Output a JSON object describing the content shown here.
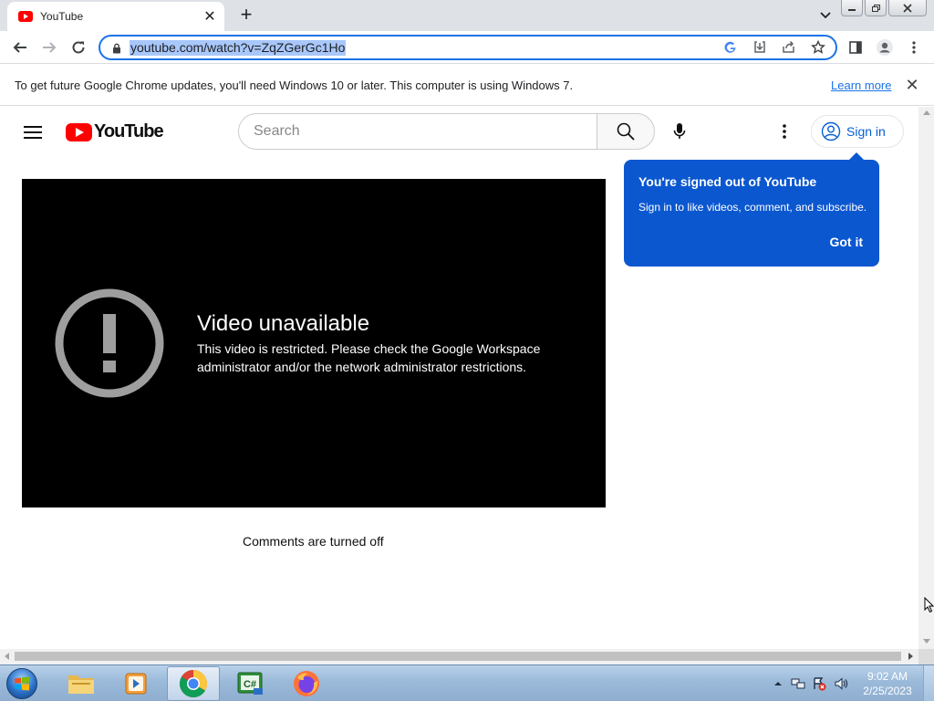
{
  "browser": {
    "tab": {
      "title": "YouTube",
      "close_glyph": "✕"
    },
    "new_tab_glyph": "+",
    "url": "youtube.com/watch?v=ZqZGerGc1Ho",
    "infobar": {
      "message": "To get future Google Chrome updates, you'll need Windows 10 or later. This computer is using Windows 7.",
      "link": "Learn more",
      "close_glyph": "✕"
    }
  },
  "youtube": {
    "logo_text": "YouTube",
    "search_placeholder": "Search",
    "sign_in_label": "Sign in",
    "player": {
      "error_title": "Video unavailable",
      "error_message": "This video is restricted. Please check the Google Workspace administrator and/or the network administrator restrictions."
    },
    "comments_off": "Comments are turned off",
    "tooltip": {
      "title": "You're signed out of YouTube",
      "text": "Sign in to like videos, comment, and subscribe.",
      "button": "Got it"
    },
    "colors": {
      "red": "#ff0000",
      "blue": "#0b57d0",
      "link": "#065fd4"
    }
  },
  "taskbar": {
    "pinned": [
      "file-explorer-icon",
      "media-player-icon",
      "chrome-icon",
      "csharp-editor-icon",
      "firefox-icon"
    ],
    "csharp_label": "C#",
    "clock_time": "9:02 AM",
    "clock_date": "2/25/2023"
  }
}
